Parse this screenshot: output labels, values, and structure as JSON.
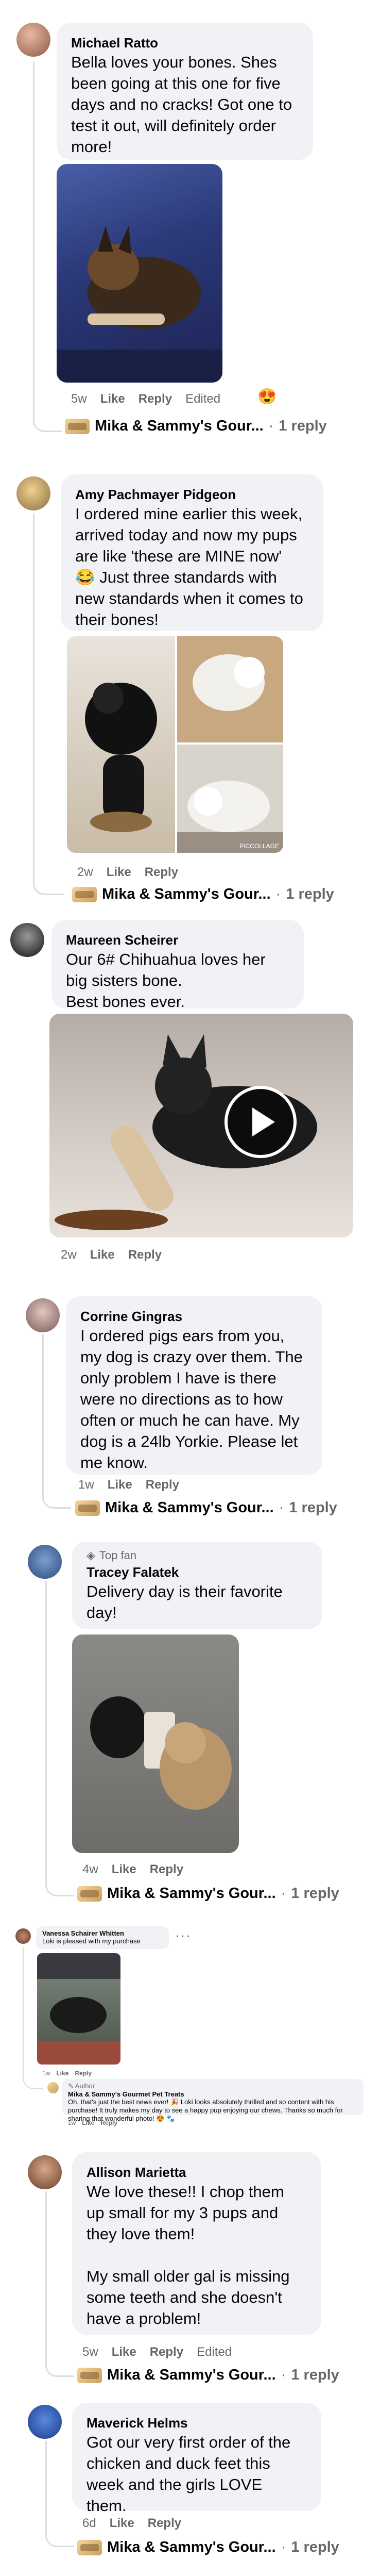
{
  "comments": [
    {
      "author": "Michael Ratto",
      "text": "Bella loves your bones. Shes been going at this one for five days and no cracks! Got one to test it out, will definitely order more!",
      "time": "5w",
      "like": "Like",
      "reply": "Reply",
      "edited": "Edited",
      "reply_author": "Mika & Sammy's Gour...",
      "reply_count": "1 reply"
    },
    {
      "author": "Amy Pachmayer Pidgeon",
      "text": "I ordered mine earlier this week, arrived today and now my pups are like 'these are MINE now' 😂 Just three standards with new standards when it comes to their bones!",
      "time": "2w",
      "like": "Like",
      "reply": "Reply",
      "collage_label": "PICCOLLAGE",
      "reply_author": "Mika & Sammy's Gour...",
      "reply_count": "1 reply"
    },
    {
      "author": "Maureen Scheirer",
      "text": "Our 6# Chihuahua loves her big sisters bone.\nBest bones ever.",
      "time": "2w",
      "like": "Like",
      "reply": "Reply"
    },
    {
      "author": "Corrine Gingras",
      "text": "I ordered pigs ears from you, my dog is crazy over them. The only problem I have is there were no directions as to how often or much he can have. My dog is a 24lb Yorkie. Please let me know.",
      "time": "1w",
      "like": "Like",
      "reply": "Reply",
      "reply_author": "Mika & Sammy's Gour...",
      "reply_count": "1 reply"
    },
    {
      "badge": "Top fan",
      "author": "Tracey Falatek",
      "text": "Delivery day is their favorite day!",
      "time": "4w",
      "like": "Like",
      "reply": "Reply",
      "reply_author": "Mika & Sammy's Gour...",
      "reply_count": "1 reply"
    },
    {
      "author": "Vanessa Schairer Whitten",
      "text": "Loki is pleased with my purchase",
      "time": "1w",
      "like": "Like",
      "reply": "Reply",
      "author_badge": "Author",
      "reply_author": "Mika & Sammy's Gourmet Pet Treats",
      "reply_text": "Oh, that's just the best news ever! 🎉 Loki looks absolutely thrilled and so content with his purchase! It truly makes my day to see a happy pup enjoying our chews. Thanks so much for sharing that wonderful photo! 😍 🐾",
      "reply_time": "1w",
      "reply_like": "Like",
      "reply_reply": "Reply"
    },
    {
      "author": "Allison Marietta",
      "text": "We love these!! I chop them up small for my 3 pups and they love them!\n\nMy small older gal is missing some teeth and she doesn't have a problem!",
      "time": "5w",
      "like": "Like",
      "reply": "Reply",
      "edited": "Edited",
      "reply_author": "Mika & Sammy's Gour...",
      "reply_count": "1 reply"
    },
    {
      "author": "Maverick Helms",
      "text": "Got our very first order of the chicken and duck feet this week and the girls LOVE them.",
      "time": "6d",
      "like": "Like",
      "reply": "Reply",
      "reply_author": "Mika & Sammy's Gour...",
      "reply_count": "1 reply"
    }
  ],
  "icons": {
    "more": "more-icon",
    "play": "play-icon",
    "reaction": "reaction-icon"
  },
  "colors": {
    "bubble": "#f0f2f5",
    "meta": "#65676b"
  }
}
